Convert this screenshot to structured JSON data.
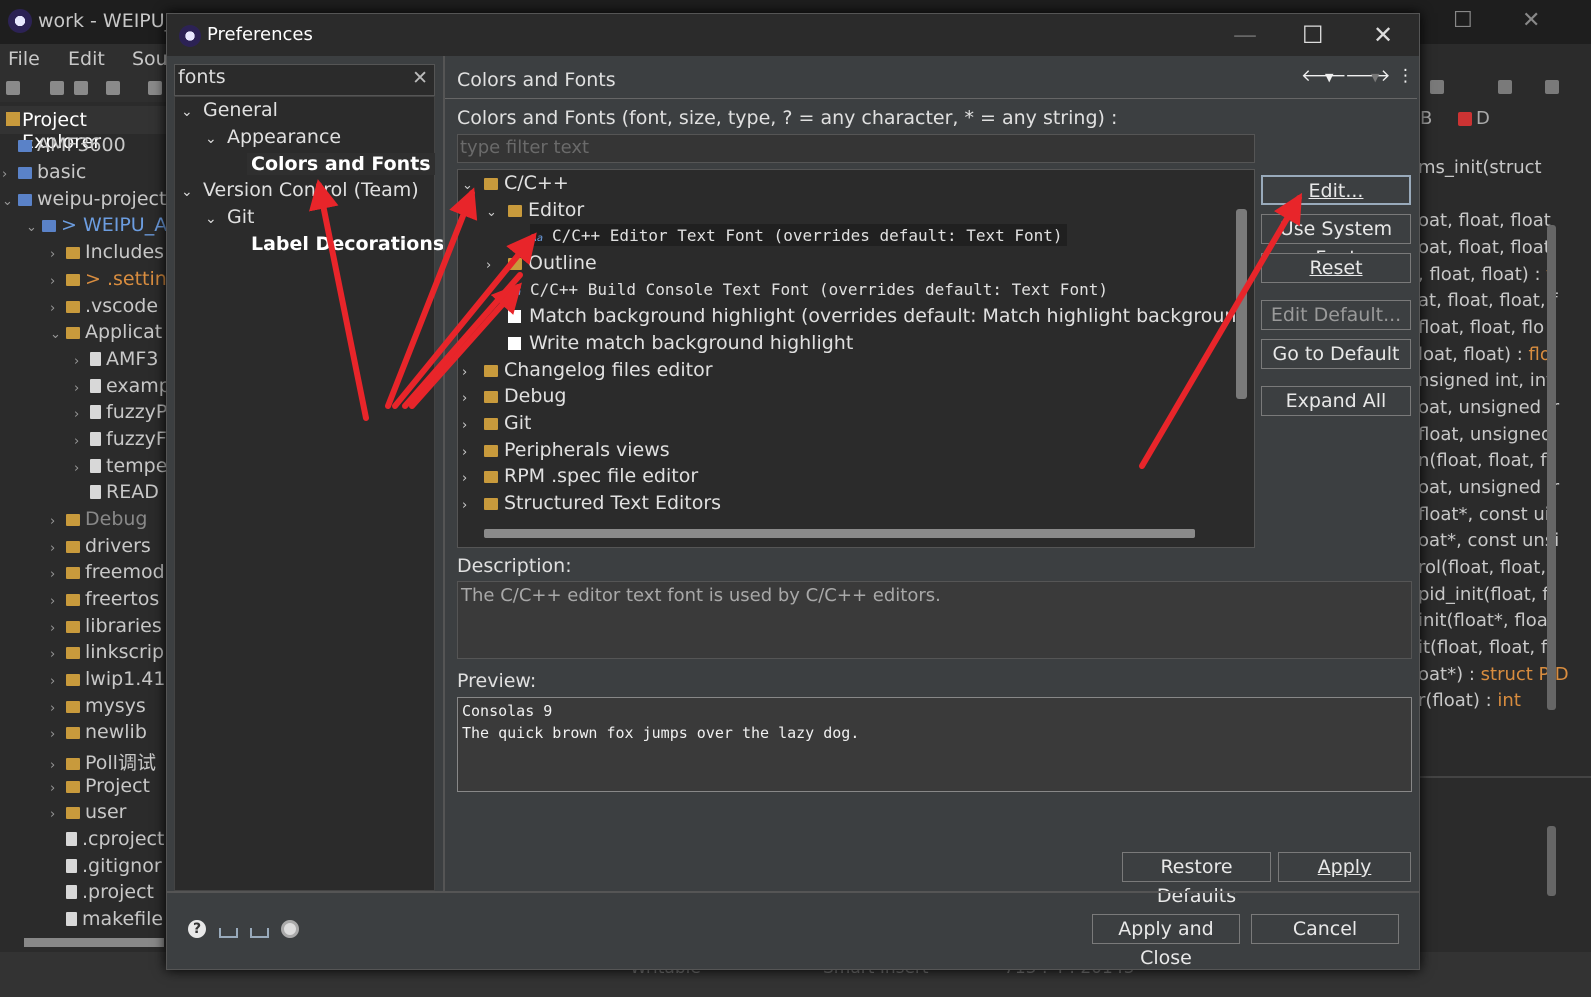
{
  "background_window": {
    "title": "work - WEIPU_AI",
    "menu": [
      "File",
      "Edit",
      "Sou"
    ],
    "explorer_title": "Project Explorer",
    "explorer_items": [
      "AMF3600",
      "basic",
      "weipu-project",
      "> WEIPU_AI",
      "Includes",
      "> .setting",
      ".vscode",
      "Applicat",
      "AMF3",
      "examp",
      "fuzzyP",
      "fuzzyF",
      "tempe",
      "READ",
      "Debug",
      "drivers",
      "freemod",
      "freertos",
      "libraries",
      "linkscrip",
      "lwip1.41",
      "mysys",
      "newlib",
      "Poll调试",
      "Project",
      "user",
      ".cproject",
      ".gitignor",
      ".project",
      "makefile"
    ],
    "status": [
      "Writable",
      "Smart Insert",
      "713 : 4 : 20143"
    ],
    "right_tabs": [
      "B",
      "D"
    ],
    "code_lines": [
      {
        "text": "ms_init(struct ",
        "type": ""
      },
      {
        "text": "oat, float, float",
        "type": ""
      },
      {
        "text": "oat, float, float,",
        "type": ""
      },
      {
        "text": ", float, float) : ",
        "type": "f"
      },
      {
        "text": "at, float, float, f",
        "type": ""
      },
      {
        "text": " float, float, flo",
        "type": ""
      },
      {
        "text": "loat, float) : ",
        "type": "flo"
      },
      {
        "text": "nsigned int, int",
        "type": ""
      },
      {
        "text": "oat, unsigned ir",
        "type": ""
      },
      {
        "text": "float, unsigned",
        "type": ""
      },
      {
        "text": "n(float, float, fl",
        "type": ""
      },
      {
        "text": "oat, unsigned ir",
        "type": ""
      },
      {
        "text": "float*, const ui",
        "type": ""
      },
      {
        "text": "oat*, const unsi",
        "type": ""
      },
      {
        "text": "rol(float, float,",
        "type": ""
      },
      {
        "text": "pid_init(float, f",
        "type": ""
      },
      {
        "text": "init(float*, floa",
        "type": ""
      },
      {
        "text": "it(float, float, fl",
        "type": ""
      },
      {
        "text": "oat*) : ",
        "type": "struct PID"
      },
      {
        "text": "r(float) : ",
        "type": "int"
      }
    ]
  },
  "dialog": {
    "title": "Preferences",
    "filter_value": "fonts",
    "nav": [
      {
        "label": "General",
        "level": 0,
        "expanded": true
      },
      {
        "label": "Appearance",
        "level": 1,
        "expanded": true
      },
      {
        "label": "Colors and Fonts",
        "level": 2,
        "selected": true
      },
      {
        "label": "Version Control (Team)",
        "level": 0,
        "expanded": true
      },
      {
        "label": "Git",
        "level": 1,
        "expanded": true
      },
      {
        "label": "Label Decorations",
        "level": 2
      }
    ],
    "page_title": "Colors and Fonts",
    "filter_hint": "Colors and Fonts (font, size, type, ? = any character, * = any string) :",
    "type_filter_placeholder": "type filter text",
    "tree": [
      {
        "label": "C/C++",
        "kind": "category",
        "expanded": true
      },
      {
        "label": "Editor",
        "kind": "category",
        "expanded": true
      },
      {
        "label": "C/C++ Editor Text Font (overrides default: Text Font)",
        "kind": "font",
        "selected": true
      },
      {
        "label": "Outline",
        "kind": "category",
        "expanded": false
      },
      {
        "label": "C/C++ Build Console Text Font (overrides default: Text Font)",
        "kind": "font"
      },
      {
        "label": "Match background highlight (overrides default: Match highlight background color)",
        "kind": "color"
      },
      {
        "label": "Write match background highlight",
        "kind": "color"
      },
      {
        "label": "Changelog files editor",
        "kind": "category",
        "expanded": false
      },
      {
        "label": "Debug",
        "kind": "category",
        "expanded": false
      },
      {
        "label": "Git",
        "kind": "category",
        "expanded": false
      },
      {
        "label": "Peripherals views",
        "kind": "category",
        "expanded": false
      },
      {
        "label": "RPM .spec file editor",
        "kind": "category",
        "expanded": false
      },
      {
        "label": "Structured Text Editors",
        "kind": "category",
        "expanded": false
      }
    ],
    "buttons": {
      "edit": "Edit...",
      "use_system_font": "Use System Font",
      "reset": "Reset",
      "edit_default": "Edit Default...",
      "go_to_default": "Go to Default",
      "expand_all": "Expand All",
      "restore_defaults": "Restore Defaults",
      "apply": "Apply",
      "apply_and_close": "Apply and Close",
      "cancel": "Cancel"
    },
    "description_label": "Description:",
    "description": "The C/C++ editor text font is used by C/C++ editors.",
    "preview_label": "Preview:",
    "preview": [
      "Consolas 9",
      "The quick brown fox jumps over the lazy dog."
    ]
  },
  "colors": {
    "annotation_arrow": "#e8252a",
    "dialog_bg": "#3c3f41",
    "panel_bg": "#2b2b2b"
  }
}
